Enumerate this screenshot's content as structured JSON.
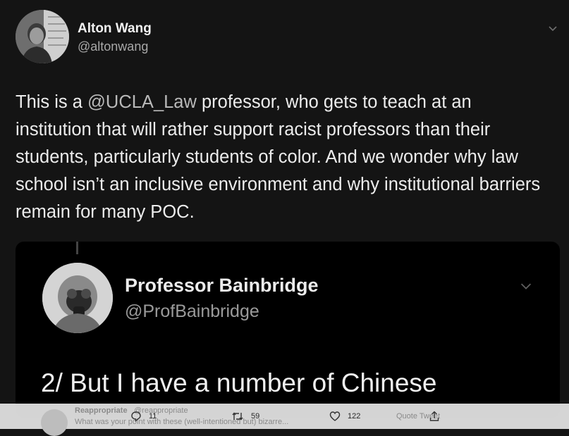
{
  "tweet": {
    "author_name": "Alton Wang",
    "author_handle": "@altonwang",
    "text_before": "This is a ",
    "mention": "@UCLA_Law",
    "text_after": " professor, who gets to teach at an institution that will rather support racist professors than their students, particularly students of color. And we wonder why law school isn’t an inclusive environment and why institutional barriers remain for many POC."
  },
  "embedded": {
    "author_name": "Professor Bainbridge",
    "author_handle": "@ProfBainbridge",
    "text": "2/ But I have a number of Chinese"
  },
  "background_reply": {
    "name": "Reappropriate",
    "handle": "@reappropriate",
    "text": "What was your point with these (well-intentioned but) bizarre...",
    "right_text": "Quote Tweet"
  },
  "actions": {
    "reply_count": "11",
    "retweet_count": "59",
    "like_count": "122"
  },
  "icons": [
    "chevron-down-icon",
    "reply-icon",
    "retweet-icon",
    "like-icon",
    "share-icon"
  ]
}
